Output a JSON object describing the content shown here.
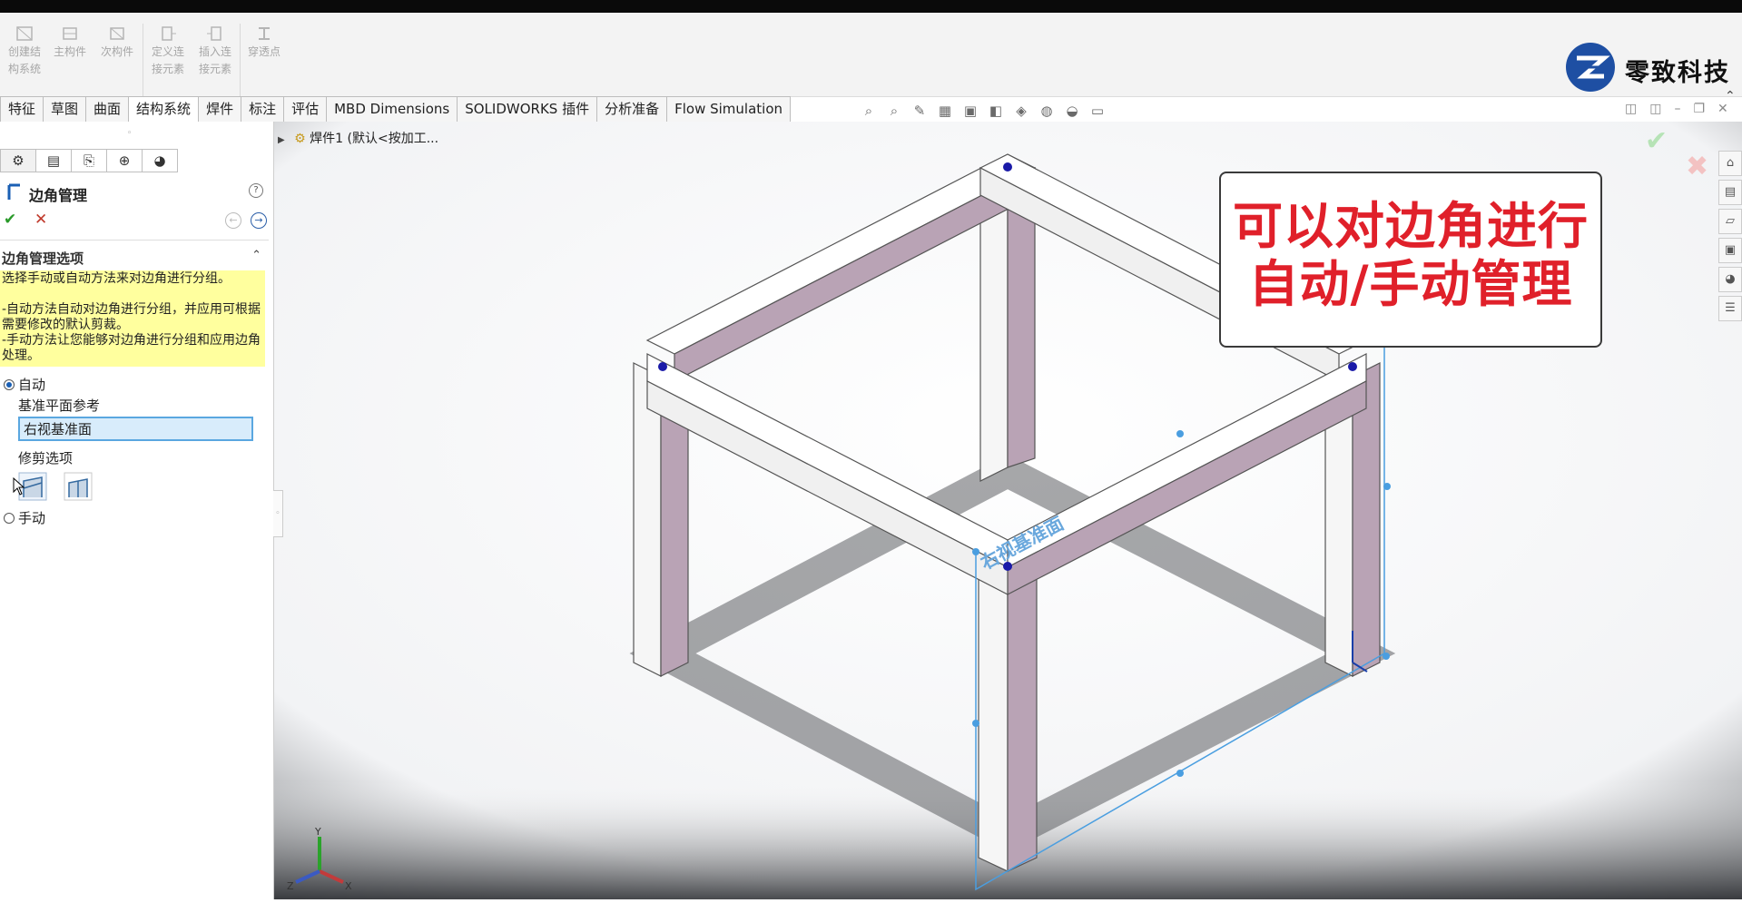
{
  "ribbon": {
    "buttons": [
      {
        "label_1": "创建结",
        "label_2": "构系统"
      },
      {
        "label_1": "主构件",
        "label_2": ""
      },
      {
        "label_1": "次构件",
        "label_2": ""
      },
      {
        "label_1": "定义连",
        "label_2": "接元素"
      },
      {
        "label_1": "插入连",
        "label_2": "接元素"
      },
      {
        "label_1": "穿透点",
        "label_2": ""
      }
    ]
  },
  "brand": {
    "name": "零致科技",
    "color": "#1e4fa3"
  },
  "command_tabs": [
    "特征",
    "草图",
    "曲面",
    "结构系统",
    "焊件",
    "标注",
    "评估",
    "MBD Dimensions",
    "SOLIDWORKS 插件",
    "分析准备",
    "Flow Simulation"
  ],
  "active_tab": "结构系统",
  "panel": {
    "title": "边角管理",
    "section_title": "边角管理选项",
    "note_lines": [
      "选择手动或自动方法来对边角进行分组。",
      "",
      "-自动方法自动对边角进行分组，并应用可根据需要修改的默认剪裁。",
      "-手动方法让您能够对边角进行分组和应用边角处理。"
    ],
    "option_auto": "自动",
    "plane_ref_label": "基准平面参考",
    "plane_ref_value": "右视基准面",
    "trim_label": "修剪选项",
    "option_manual": "手动",
    "selected_option": "自动"
  },
  "tree": {
    "root": "焊件1 (默认<按加工..."
  },
  "callout": {
    "line1": "可以对边角进行",
    "line2": "自动/手动管理",
    "color": "#e0202a"
  },
  "model": {
    "plane_label": "右视基准面",
    "frame_color": "#b9a3b5",
    "selection_color": "#4a9ee0"
  },
  "triad": {
    "x": "X",
    "y": "Y",
    "z": "Z"
  },
  "colors": {
    "accent": "#1a5fb4",
    "note_bg": "#ffff9e",
    "ok": "#2a9a2a",
    "cancel": "#c0392b"
  }
}
